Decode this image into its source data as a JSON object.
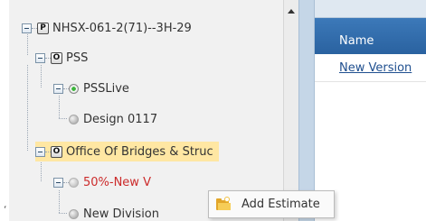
{
  "stray_text": "‘",
  "tree": {
    "nodes": [
      {
        "label": "NHSX-061-2(71)--3H-29",
        "badge": "P"
      },
      {
        "label": "PSS",
        "badge": "O"
      },
      {
        "label": "PSSLive"
      },
      {
        "label": "Design 0117"
      },
      {
        "label": "Office Of Bridges & Struc",
        "badge": "O"
      },
      {
        "label": "50%-New V"
      },
      {
        "label": "New Division"
      }
    ]
  },
  "grid": {
    "column_header": "Name",
    "rows": [
      "New Version"
    ]
  },
  "context_menu": {
    "items": [
      {
        "label": "Add Estimate",
        "icon": "folder-add-icon"
      }
    ]
  },
  "colors": {
    "selection_highlight": "#ffe7a3",
    "grid_header": "#2f6aab",
    "red_text": "#cc2b2b",
    "link": "#1f4f8f"
  }
}
